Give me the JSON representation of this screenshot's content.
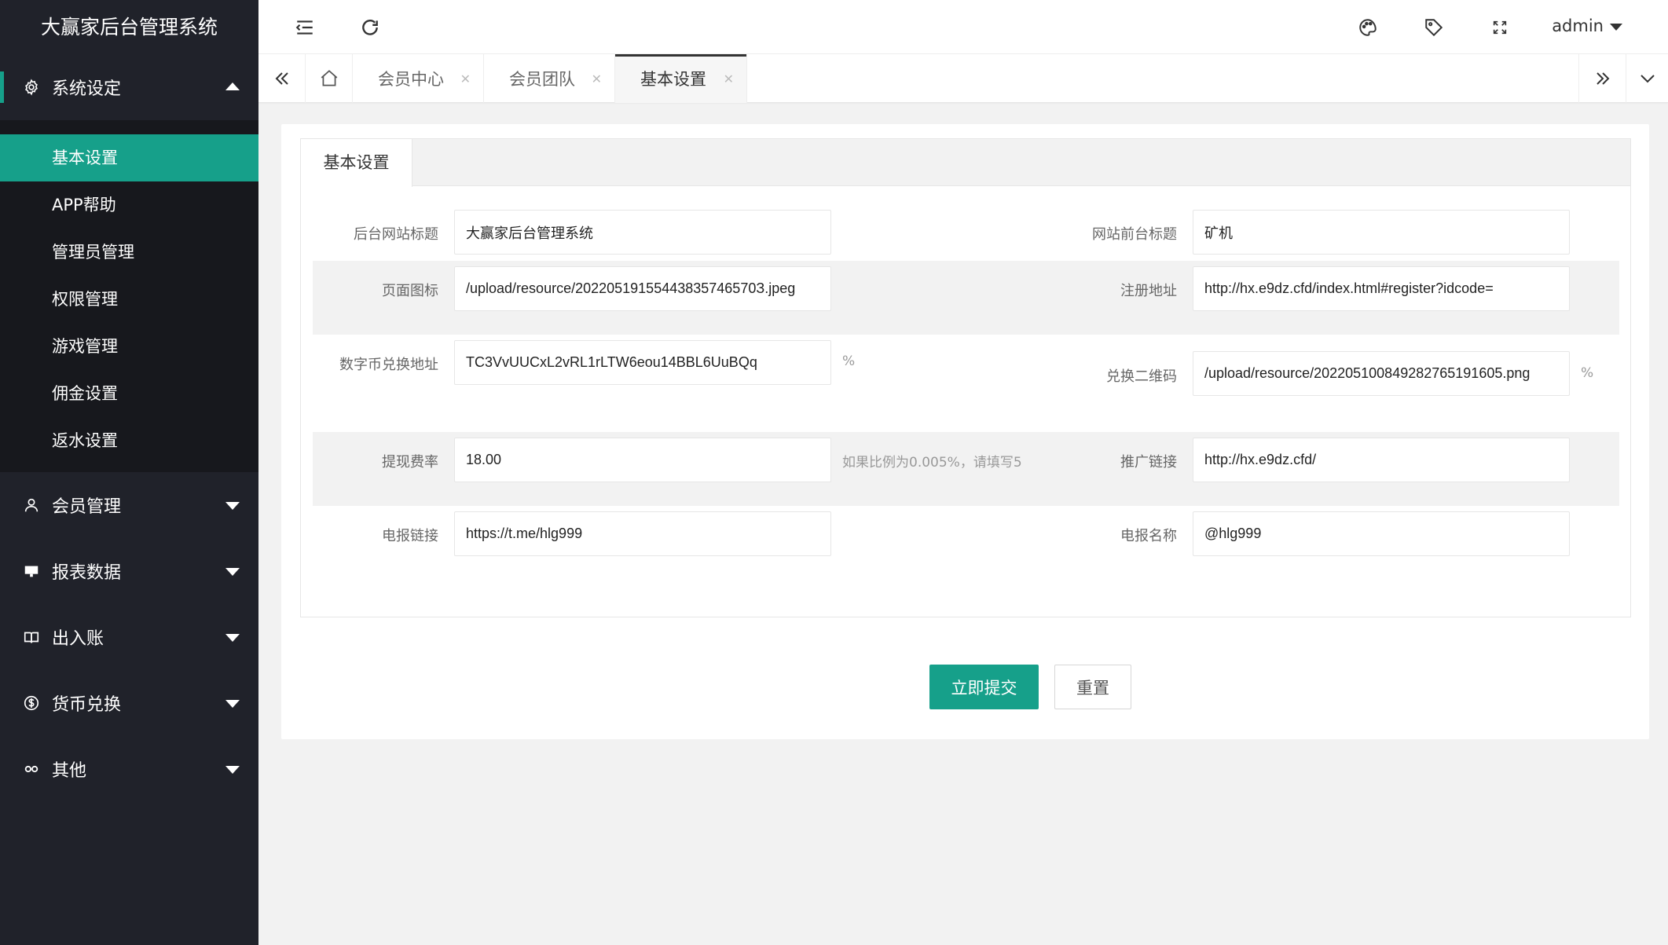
{
  "app": {
    "title": "大赢家后台管理系统"
  },
  "sidebar": {
    "groups": [
      {
        "label": "系统设定",
        "icon": "gear-icon",
        "expanded": true,
        "items": [
          "基本设置",
          "APP帮助",
          "管理员管理",
          "权限管理",
          "游戏管理",
          "佣金设置",
          "返水设置"
        ],
        "active_item": "基本设置"
      },
      {
        "label": "会员管理",
        "icon": "user-icon"
      },
      {
        "label": "报表数据",
        "icon": "chart-icon"
      },
      {
        "label": "出入账",
        "icon": "book-icon"
      },
      {
        "label": "货币兑换",
        "icon": "dollar-icon"
      },
      {
        "label": "其他",
        "icon": "link-icon"
      }
    ]
  },
  "header": {
    "user": "admin",
    "icons": [
      "menu-fold-icon",
      "refresh-icon",
      "palette-icon",
      "tag-icon",
      "fullscreen-icon"
    ]
  },
  "tabs": [
    {
      "label": "会员中心",
      "active": false
    },
    {
      "label": "会员团队",
      "active": false
    },
    {
      "label": "基本设置",
      "active": true
    }
  ],
  "panel": {
    "tab_label": "基本设置"
  },
  "form": {
    "admin_title": {
      "label": "后台网站标题",
      "value": "大赢家后台管理系统"
    },
    "front_title": {
      "label": "网站前台标题",
      "value": "矿机"
    },
    "page_icon": {
      "label": "页面图标",
      "value": "/upload/resource/20220519155443835746570З.jpeg"
    },
    "register_url": {
      "label": "注册地址",
      "value": "http://hx.e9dz.cfd/index.html#register?idcode="
    },
    "coin_address": {
      "label": "数字币兑换地址",
      "value": "TC3VvUUCxL2vRL1rLTW6eou14BBL6UuBQq",
      "suffix": "%"
    },
    "exchange_qr": {
      "label": "兑换二维码",
      "value": "/upload/resource/20220510084928276519160​5.png",
      "suffix": "%"
    },
    "withdraw_fee": {
      "label": "提现费率",
      "value": "18.00",
      "hint": "如果比例为0.005%，请填写5"
    },
    "promo_link": {
      "label": "推广链接",
      "value": "http://hx.e9dz.cfd/"
    },
    "tg_link": {
      "label": "电报链接",
      "value": "https://t.me/hlg999"
    },
    "tg_name": {
      "label": "电报名称",
      "value": "@hlg999"
    }
  },
  "buttons": {
    "submit": "立即提交",
    "reset": "重置"
  },
  "colors": {
    "accent": "#16a08a",
    "sidebar_bg": "#20222a",
    "sidebar_sub_bg": "#17181d"
  }
}
